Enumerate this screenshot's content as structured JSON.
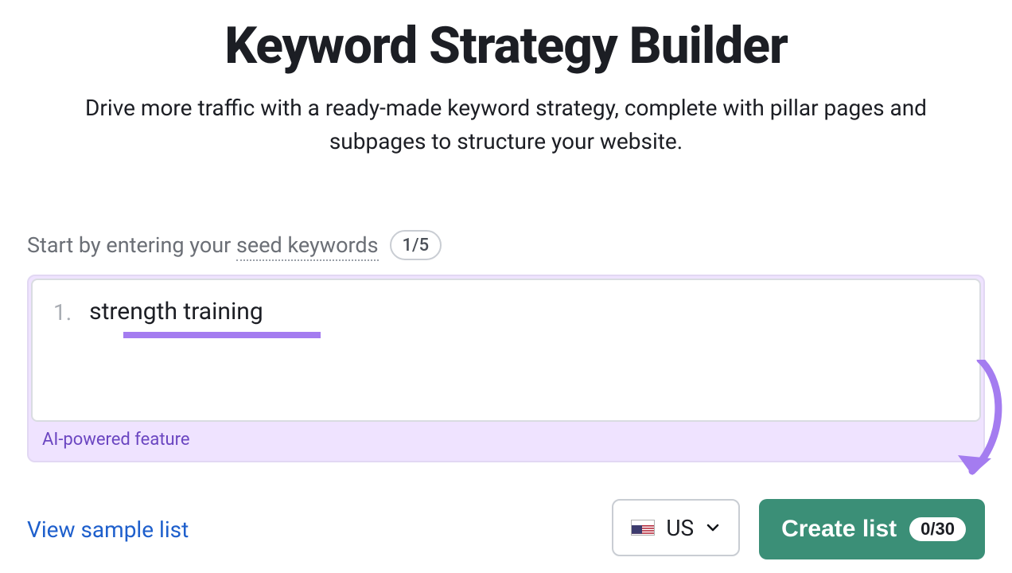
{
  "header": {
    "title": "Keyword Strategy Builder",
    "subtitle": "Drive more traffic with a ready-made keyword strategy, complete with pillar pages and subpages to structure your website."
  },
  "prompt": {
    "prefix": "Start by entering your ",
    "seed_label": "seed keywords",
    "count": "1/5"
  },
  "input": {
    "row_number": "1.",
    "keyword_value": "strength training",
    "ai_caption": "AI-powered feature"
  },
  "footer": {
    "view_sample": "View sample list",
    "country": {
      "code": "US"
    },
    "create_button": {
      "label": "Create list",
      "count": "0/30"
    }
  }
}
